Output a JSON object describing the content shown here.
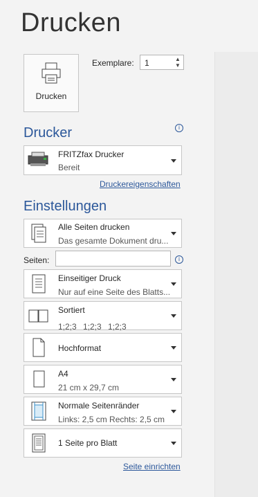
{
  "page": {
    "title": "Drucken"
  },
  "print": {
    "button_label": "Drucken"
  },
  "copies": {
    "label": "Exemplare:",
    "value": "1"
  },
  "printer_section": {
    "heading": "Drucker",
    "name": "FRITZfax Drucker",
    "status": "Bereit",
    "properties_link": "Druckereigenschaften"
  },
  "settings": {
    "heading": "Einstellungen",
    "range": {
      "line1": "Alle Seiten drucken",
      "line2": "Das gesamte Dokument dru..."
    },
    "pages": {
      "label": "Seiten:",
      "value": ""
    },
    "sides": {
      "line1": "Einseitiger Druck",
      "line2": "Nur auf eine Seite des Blatts..."
    },
    "collate": {
      "line1": "Sortiert",
      "seq1": "1;2;3",
      "seq2": "1;2;3",
      "seq3": "1;2;3"
    },
    "orientation": {
      "line1": "Hochformat"
    },
    "paper": {
      "line1": "A4",
      "line2": "21 cm x 29,7 cm"
    },
    "margins": {
      "line1": "Normale Seitenränder",
      "line2": "Links: 2,5 cm   Rechts: 2,5 cm"
    },
    "pages_per_sheet": {
      "line1": "1 Seite pro Blatt"
    },
    "page_setup_link": "Seite einrichten"
  },
  "colors": {
    "accent": "#2b579a",
    "background": "#f3f3f3"
  }
}
